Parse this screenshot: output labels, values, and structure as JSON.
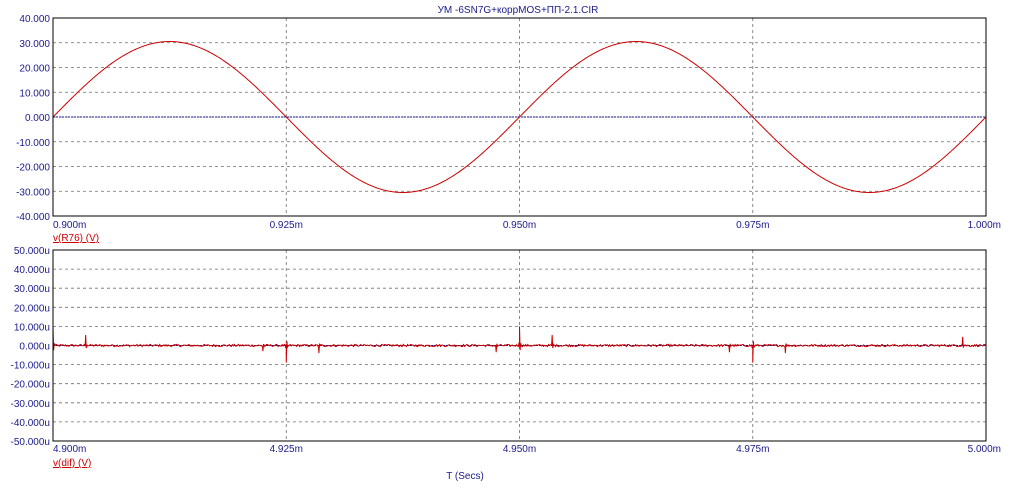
{
  "window": {
    "title": "УМ -6SN7G+коррMOS+ПП-2.1.CIR",
    "x_axis_title": "T (Secs)"
  },
  "colors": {
    "background": "#ffffff",
    "frame": "#000000",
    "grid": "#6e6e6e",
    "text": "#1a1a8c",
    "trace": "#cc0000",
    "zero_line": "#1a1a8c"
  },
  "chart_data": [
    {
      "type": "line",
      "series_label": "v(R76) (V)",
      "x_tick_labels": [
        "0.900m",
        "0.925m",
        "0.950m",
        "0.975m",
        "1.000m"
      ],
      "y_tick_labels": [
        "40.000",
        "30.000",
        "20.000",
        "10.000",
        "0.000",
        "-10.000",
        "-20.000",
        "-30.000",
        "-40.000"
      ],
      "xlim": [
        0.0009,
        0.001
      ],
      "ylim": [
        -40,
        40
      ],
      "grid": true,
      "series": [
        {
          "name": "v(R76) (V)",
          "waveform": "sine",
          "amplitude": 30.5,
          "frequency_hz": 20000,
          "x": [
            0.0009,
            0.0009125,
            0.000925,
            0.0009375,
            0.00095,
            0.0009625,
            0.000975,
            0.0009875,
            0.001
          ],
          "y": [
            0,
            30.5,
            0,
            -30.5,
            0,
            30.5,
            0,
            -30.5,
            0
          ]
        }
      ]
    },
    {
      "type": "line",
      "series_label": "v(dif) (V)",
      "x_tick_labels": [
        "4.900m",
        "4.925m",
        "4.950m",
        "4.975m",
        "5.000m"
      ],
      "y_tick_labels": [
        "50.000u",
        "40.000u",
        "30.000u",
        "20.000u",
        "10.000u",
        "0.000u",
        "-10.000u",
        "-20.000u",
        "-30.000u",
        "-40.000u",
        "-50.000u"
      ],
      "xlim": [
        0.0049,
        0.005
      ],
      "ylim": [
        -50,
        50
      ],
      "y_unit_prefix": "u",
      "grid": true,
      "series": [
        {
          "name": "v(dif) (V)",
          "baseline": 0,
          "noise_amplitude": 0.6,
          "spikes": [
            {
              "x": 0.0049,
              "y": 10
            },
            {
              "x": 0.0049035,
              "y": 5.5
            },
            {
              "x": 0.0049225,
              "y": -3
            },
            {
              "x": 0.004925,
              "y": -9
            },
            {
              "x": 0.0049285,
              "y": -4
            },
            {
              "x": 0.0049475,
              "y": -3.5
            },
            {
              "x": 0.00495,
              "y": 10
            },
            {
              "x": 0.0049535,
              "y": 5.5
            },
            {
              "x": 0.0049725,
              "y": -3.5
            },
            {
              "x": 0.004975,
              "y": -9
            },
            {
              "x": 0.0049785,
              "y": -4
            },
            {
              "x": 0.0049975,
              "y": 4.5
            }
          ]
        }
      ]
    }
  ]
}
